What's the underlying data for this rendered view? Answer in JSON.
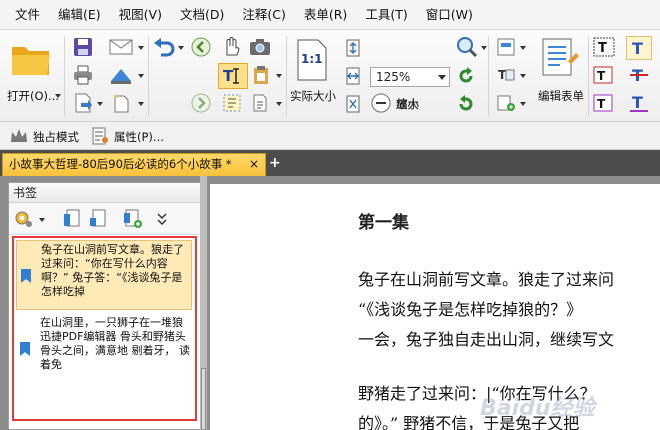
{
  "menu": [
    "文件",
    "编辑(E)",
    "视图(V)",
    "文档(D)",
    "注释(C)",
    "表单(R)",
    "工具(T)",
    "窗口(W)"
  ],
  "ribbon": {
    "open_label": "打开(O)...",
    "zoom_value": "125%",
    "actual_size_label": "实际大小",
    "actual_size_glyph": "1:1",
    "zoom_in_label": "放大",
    "zoom_out_label": "缩小",
    "edit_form_label": "编辑表单"
  },
  "toolbar2": {
    "exclusive_mode_label": "独占模式",
    "properties_label": "属性(P)..."
  },
  "tab": {
    "title": "小故事大哲理-80后90后必读的6个小故事 *",
    "close": "×",
    "new": "+"
  },
  "bookmarks": {
    "header": "书签",
    "items": [
      {
        "text": "兔子在山洞前写文章。狼走了过来问：“你在写什么内容啊？” 兔子答：“《浅谈兔子是怎样吃掉"
      },
      {
        "text": "在山洞里，一只狮子在一堆狼 迅捷PDF编辑器 骨头和野猪头骨头之间，满意地 剔着牙， 读着免"
      }
    ]
  },
  "document": {
    "title": "第一集",
    "lines": [
      "兔子在山洞前写文章。狼走了过来问",
      "“《浅谈兔子是怎样吃掉狼的？》",
      "一会，兔子独自走出山洞，继续写文",
      "野猪走了过来问：|“你在写什么？",
      "的》。” 野猪不信，于是兔子又把"
    ]
  },
  "watermark": "Baidu经验"
}
